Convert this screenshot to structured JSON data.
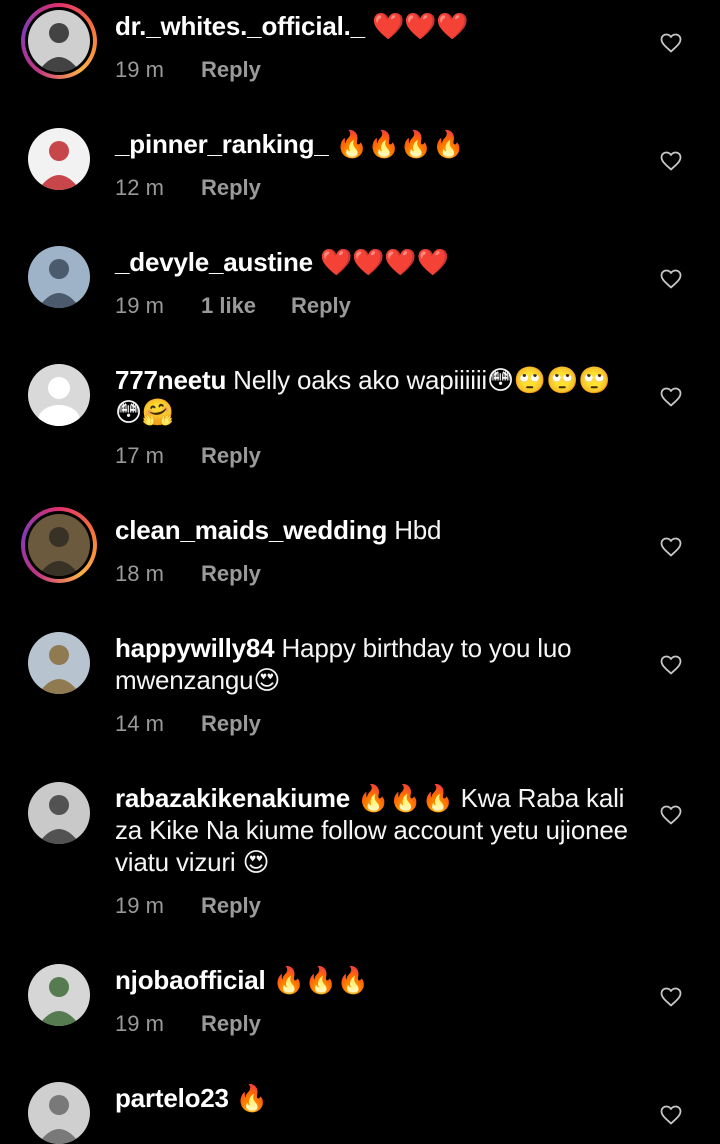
{
  "comments": [
    {
      "username": "dr._whites._official._",
      "text": "❤️❤️❤️",
      "time": "19 m",
      "likes": "",
      "reply_label": "Reply",
      "story_ring": true,
      "avatar_colors": [
        "#cfcfcf",
        "#2a2a2a"
      ]
    },
    {
      "username": "_pinner_ranking_",
      "text": "🔥🔥🔥🔥",
      "time": "12 m",
      "likes": "",
      "reply_label": "Reply",
      "story_ring": false,
      "avatar_colors": [
        "#f2f2f2",
        "#c0282d"
      ]
    },
    {
      "username": "_devyle_austine",
      "text": "❤️❤️❤️❤️",
      "time": "19 m",
      "likes": "1 like",
      "reply_label": "Reply",
      "story_ring": false,
      "avatar_colors": [
        "#9fb3c8",
        "#3c4a5c"
      ]
    },
    {
      "username": "777neetu",
      "text": "Nelly oaks ako wapiiiiii😳🙄🙄🙄😳🤗",
      "time": "17 m",
      "likes": "",
      "reply_label": "Reply",
      "story_ring": false,
      "avatar_colors": [
        "#d9d9d9",
        "#ffffff"
      ]
    },
    {
      "username": "clean_maids_wedding",
      "text": "Hbd",
      "time": "18 m",
      "likes": "",
      "reply_label": "Reply",
      "story_ring": true,
      "avatar_colors": [
        "#6b5a3e",
        "#2f2a22"
      ]
    },
    {
      "username": "happywilly84",
      "text": "Happy birthday to you luo mwenzangu😍",
      "time": "14 m",
      "likes": "",
      "reply_label": "Reply",
      "story_ring": false,
      "avatar_colors": [
        "#b7c4cf",
        "#8a6d3b"
      ]
    },
    {
      "username": "rabazakikenakiume",
      "text": "🔥🔥🔥 Kwa Raba kali za Kike Na kiume follow account yetu ujionee viatu vizuri 😍",
      "time": "19 m",
      "likes": "",
      "reply_label": "Reply",
      "story_ring": false,
      "avatar_colors": [
        "#c9c9c9",
        "#3d3d3d"
      ]
    },
    {
      "username": "njobaofficial",
      "text": "🔥🔥🔥",
      "time": "19 m",
      "likes": "",
      "reply_label": "Reply",
      "story_ring": false,
      "avatar_colors": [
        "#d6d6d6",
        "#3f6b3a"
      ]
    },
    {
      "username": "partelo23",
      "text": "🔥",
      "time": "",
      "likes": "",
      "reply_label": "",
      "story_ring": false,
      "avatar_colors": [
        "#cfcfcf",
        "#6a6a6a"
      ]
    }
  ],
  "icons": {
    "like": "heart-outline-icon"
  },
  "colors": {
    "background": "#000000",
    "text": "#f5f5f5",
    "secondary_text": "#9a9a9a",
    "icon": "#c7c7c7"
  }
}
